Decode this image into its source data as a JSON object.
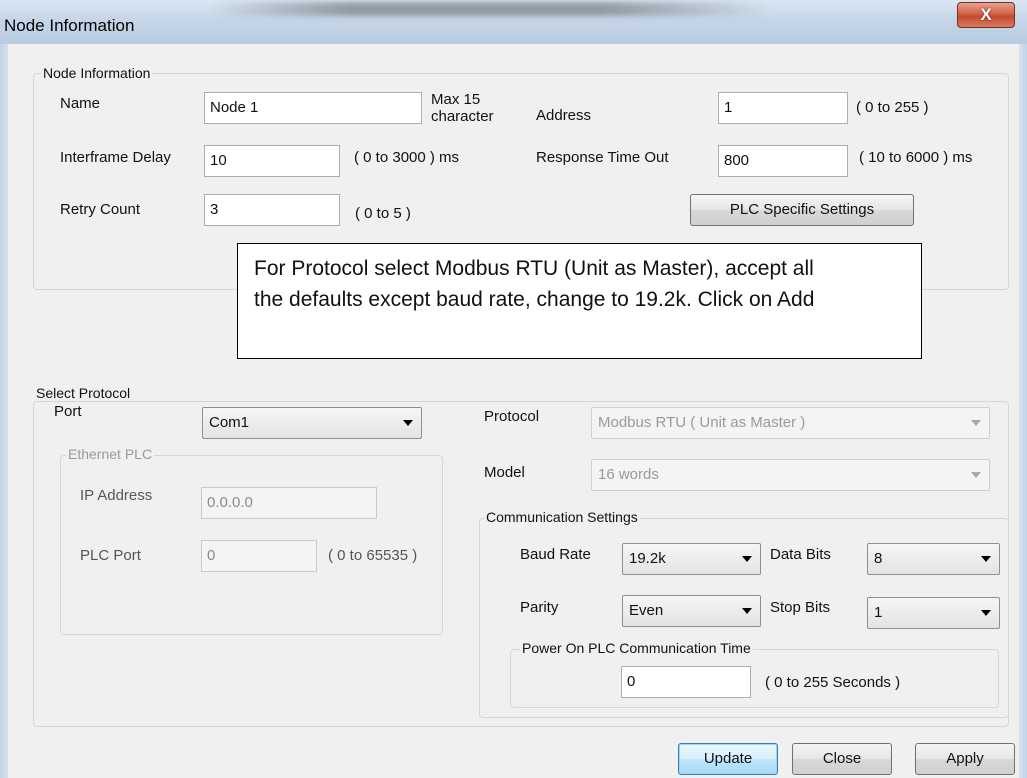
{
  "window": {
    "title": "Node Information",
    "close_glyph": "X"
  },
  "node_info": {
    "legend": "Node Information",
    "name_label": "Name",
    "name_value": "Node 1",
    "name_hint_line1": "Max 15",
    "name_hint_line2": "character",
    "address_label": "Address",
    "address_value": "1",
    "address_range": "( 0 to 255 )",
    "interframe_label": "Interframe Delay",
    "interframe_value": "10",
    "interframe_range": "( 0 to 3000 ) ms",
    "response_label": "Response Time Out",
    "response_value": "800",
    "response_range": "( 10 to 6000 ) ms",
    "retry_label": "Retry Count",
    "retry_value": "3",
    "retry_range": "( 0 to 5 )",
    "plc_settings_button": "PLC Specific Settings"
  },
  "note": {
    "line1": "For Protocol select Modbus RTU (Unit as Master), accept all",
    "line2": "the defaults except baud rate, change to 19.2k.  Click on Add"
  },
  "protocol": {
    "legend": "Select Protocol",
    "port_label": "Port",
    "port_value": "Com1",
    "protocol_label": "Protocol",
    "protocol_value": "Modbus RTU ( Unit as Master )",
    "model_label": "Model",
    "model_value": "16 words",
    "ethernet": {
      "legend": "Ethernet PLC",
      "ip_label": "IP Address",
      "ip_value": "0.0.0.0",
      "port_label": "PLC Port",
      "port_value": "0",
      "port_range": "( 0 to 65535 )"
    },
    "comm": {
      "legend": "Communication Settings",
      "baud_label": "Baud Rate",
      "baud_value": "19.2k",
      "data_bits_label": "Data Bits",
      "data_bits_value": "8",
      "parity_label": "Parity",
      "parity_value": "Even",
      "stop_bits_label": "Stop Bits",
      "stop_bits_value": "1",
      "power_on": {
        "legend": "Power On PLC Communication Time",
        "value": "0",
        "range": "( 0 to 255 Seconds )"
      }
    }
  },
  "buttons": {
    "update": "Update",
    "close": "Close",
    "apply": "Apply"
  },
  "colors": {
    "titlebar": "#c6d6e8",
    "close_button": "#c24a2e",
    "dialog_background": "#f0f0f0",
    "default_button_border": "#3c7fb1"
  }
}
